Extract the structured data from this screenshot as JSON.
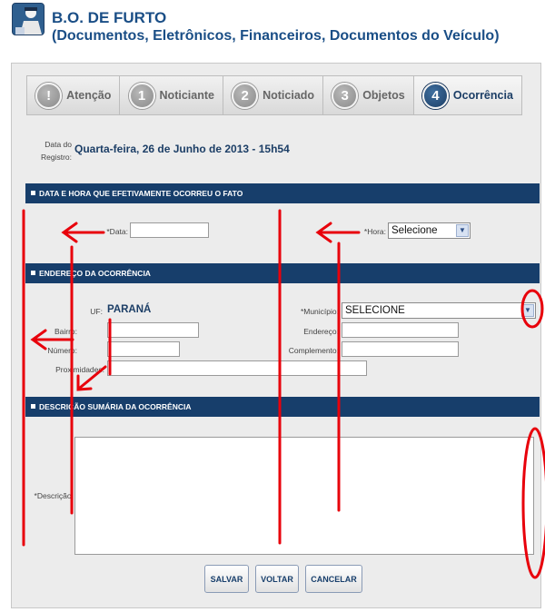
{
  "header": {
    "title_line1": "B.O. DE FURTO",
    "title_line2": "(Documentos, Eletrônicos, Financeiros, Documentos do Veículo)",
    "logo_icon": "police-officer-icon"
  },
  "steps": [
    {
      "number": "!",
      "label": "Atenção",
      "active": false
    },
    {
      "number": "1",
      "label": "Noticiante",
      "active": false
    },
    {
      "number": "2",
      "label": "Noticiado",
      "active": false
    },
    {
      "number": "3",
      "label": "Objetos",
      "active": false
    },
    {
      "number": "4",
      "label": "Ocorrência",
      "active": true
    }
  ],
  "registro": {
    "label": "Data do Registro:",
    "value": "Quarta-feira, 26 de Junho de 2013 - 15h54"
  },
  "section_datahora": {
    "title": "DATA E HORA QUE EFETIVAMENTE OCORREU O FATO",
    "data_label": "*Data:",
    "data_value": "",
    "hora_label": "*Hora:",
    "hora_selected": "Selecione"
  },
  "section_endereco": {
    "title": "ENDEREÇO DA OCORRÊNCIA",
    "uf_label": "UF:",
    "uf_value": "PARANÁ",
    "municipio_label": "*Município:",
    "municipio_selected": "SELECIONE",
    "bairro_label": "Bairro:",
    "endereco_label": "Endereço:",
    "numero_label": "Número:",
    "complemento_label": "Complemento:",
    "proximidades_label": "Proximidades:"
  },
  "section_descricao": {
    "title": "DESCRIÇÃO SUMÁRIA DA OCORRÊNCIA",
    "descricao_label": "*Descrição:"
  },
  "buttons": {
    "save": "SALVAR",
    "back": "VOLTAR",
    "cancel": "CANCELAR"
  },
  "colors": {
    "header_title": "#1a4e86",
    "section_bar": "#173e6b",
    "annotation": "#e8000b"
  }
}
